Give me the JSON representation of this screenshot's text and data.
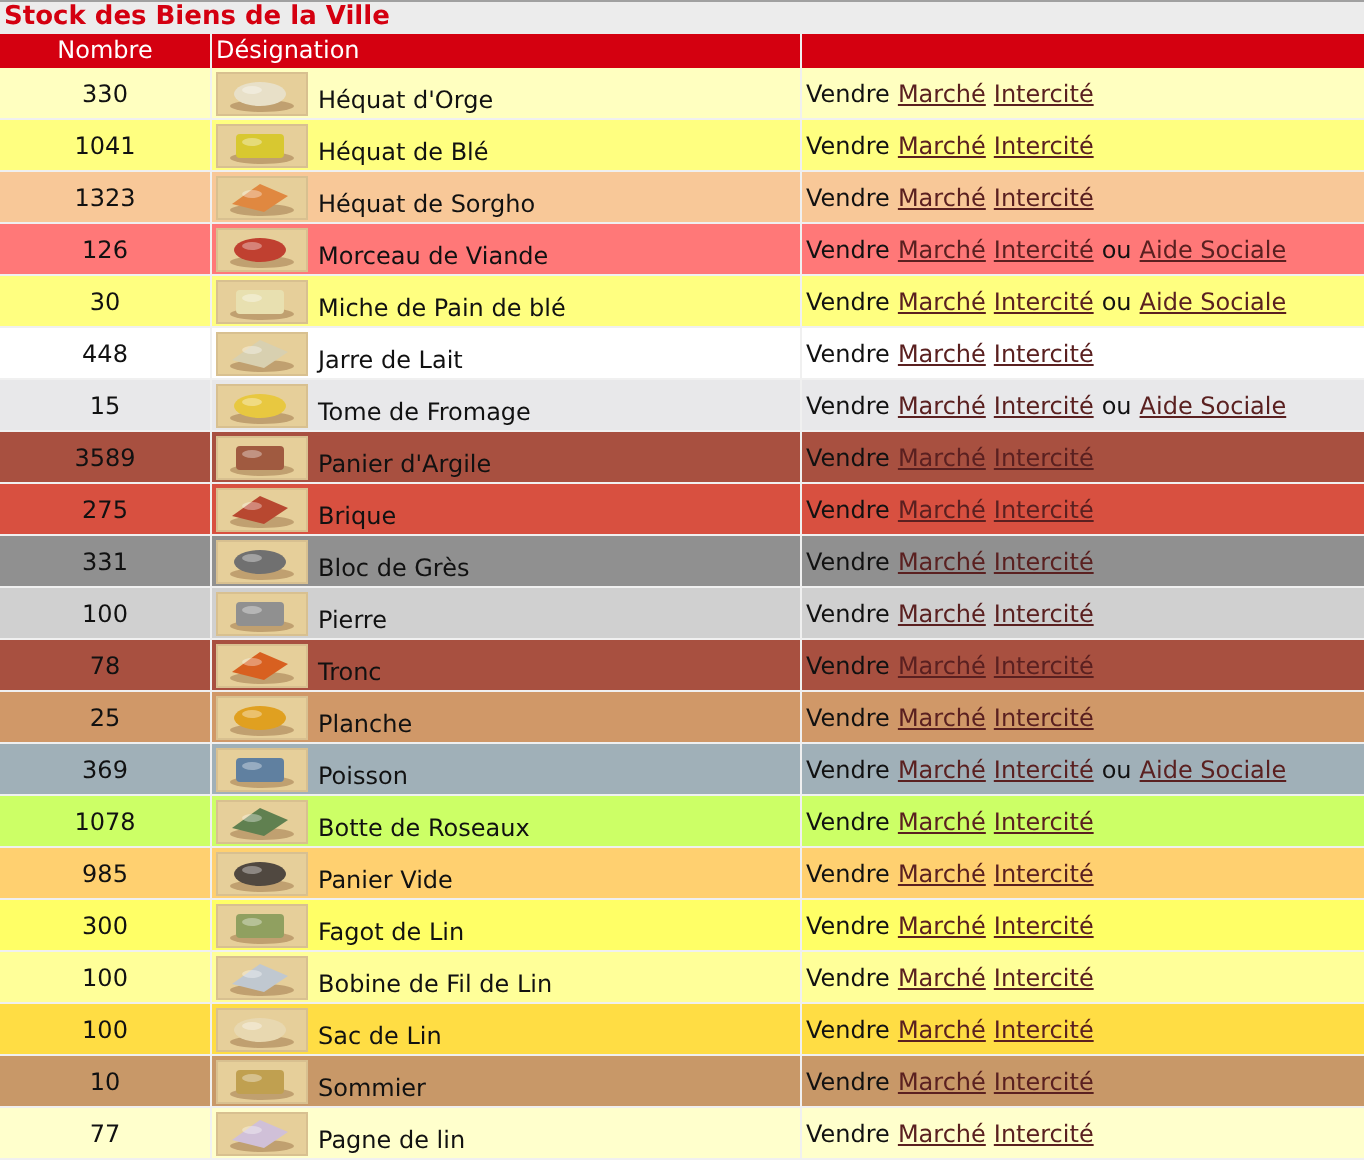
{
  "title": "Stock des Biens de la Ville",
  "columns": [
    "Nombre",
    "Désignation"
  ],
  "rows": [
    {
      "count": "330",
      "name": "Héquat d'Orge",
      "color": "#ffffc0",
      "actions": [
        {
          "kind": "text",
          "text": "Vendre"
        },
        {
          "kind": "link",
          "text": "Marché"
        },
        {
          "kind": "link",
          "text": "Intercité"
        }
      ]
    },
    {
      "count": "1041",
      "name": "Héquat de Blé",
      "color": "#ffff80",
      "actions": [
        {
          "kind": "text",
          "text": "Vendre"
        },
        {
          "kind": "link",
          "text": "Marché"
        },
        {
          "kind": "link",
          "text": "Intercité"
        }
      ]
    },
    {
      "count": "1323",
      "name": "Héquat de Sorgho",
      "color": "#f8c898",
      "actions": [
        {
          "kind": "text",
          "text": "Vendre"
        },
        {
          "kind": "link",
          "text": "Marché"
        },
        {
          "kind": "link",
          "text": "Intercité"
        }
      ]
    },
    {
      "count": "126",
      "name": "Morceau de Viande",
      "color": "#ff7878",
      "actions": [
        {
          "kind": "text",
          "text": "Vendre"
        },
        {
          "kind": "link",
          "text": "Marché"
        },
        {
          "kind": "link",
          "text": "Intercité"
        },
        {
          "kind": "text",
          "text": "ou"
        },
        {
          "kind": "link",
          "text": "Aide Sociale"
        }
      ]
    },
    {
      "count": "30",
      "name": "Miche de Pain de blé",
      "color": "#ffff80",
      "actions": [
        {
          "kind": "text",
          "text": "Vendre"
        },
        {
          "kind": "link",
          "text": "Marché"
        },
        {
          "kind": "link",
          "text": "Intercité"
        },
        {
          "kind": "text",
          "text": "ou"
        },
        {
          "kind": "link",
          "text": "Aide Sociale"
        }
      ]
    },
    {
      "count": "448",
      "name": "Jarre de Lait",
      "color": "#ffffff",
      "actions": [
        {
          "kind": "text",
          "text": "Vendre"
        },
        {
          "kind": "link",
          "text": "Marché"
        },
        {
          "kind": "link",
          "text": "Intercité"
        }
      ]
    },
    {
      "count": "15",
      "name": "Tome de Fromage",
      "color": "#e8e8ea",
      "actions": [
        {
          "kind": "text",
          "text": "Vendre"
        },
        {
          "kind": "link",
          "text": "Marché"
        },
        {
          "kind": "link",
          "text": "Intercité"
        },
        {
          "kind": "text",
          "text": "ou"
        },
        {
          "kind": "link",
          "text": "Aide Sociale"
        }
      ]
    },
    {
      "count": "3589",
      "name": "Panier d'Argile",
      "color": "#a85040",
      "actions": [
        {
          "kind": "text",
          "text": "Vendre"
        },
        {
          "kind": "link",
          "text": "Marché"
        },
        {
          "kind": "link",
          "text": "Intercité"
        }
      ]
    },
    {
      "count": "275",
      "name": "Brique",
      "color": "#d85040",
      "actions": [
        {
          "kind": "text",
          "text": "Vendre"
        },
        {
          "kind": "link",
          "text": "Marché"
        },
        {
          "kind": "link",
          "text": "Intercité"
        }
      ]
    },
    {
      "count": "331",
      "name": "Bloc de Grès",
      "color": "#909090",
      "actions": [
        {
          "kind": "text",
          "text": "Vendre"
        },
        {
          "kind": "link",
          "text": "Marché"
        },
        {
          "kind": "link",
          "text": "Intercité"
        }
      ]
    },
    {
      "count": "100",
      "name": "Pierre",
      "color": "#d0d0d0",
      "actions": [
        {
          "kind": "text",
          "text": "Vendre"
        },
        {
          "kind": "link",
          "text": "Marché"
        },
        {
          "kind": "link",
          "text": "Intercité"
        }
      ]
    },
    {
      "count": "78",
      "name": "Tronc",
      "color": "#a85040",
      "actions": [
        {
          "kind": "text",
          "text": "Vendre"
        },
        {
          "kind": "link",
          "text": "Marché"
        },
        {
          "kind": "link",
          "text": "Intercité"
        }
      ]
    },
    {
      "count": "25",
      "name": "Planche",
      "color": "#d09868",
      "actions": [
        {
          "kind": "text",
          "text": "Vendre"
        },
        {
          "kind": "link",
          "text": "Marché"
        },
        {
          "kind": "link",
          "text": "Intercité"
        }
      ]
    },
    {
      "count": "369",
      "name": "Poisson",
      "color": "#a0b0b8",
      "actions": [
        {
          "kind": "text",
          "text": "Vendre"
        },
        {
          "kind": "link",
          "text": "Marché"
        },
        {
          "kind": "link",
          "text": "Intercité"
        },
        {
          "kind": "text",
          "text": "ou"
        },
        {
          "kind": "link",
          "text": "Aide Sociale"
        }
      ]
    },
    {
      "count": "1078",
      "name": "Botte de Roseaux",
      "color": "#ccff66",
      "actions": [
        {
          "kind": "text",
          "text": "Vendre"
        },
        {
          "kind": "link",
          "text": "Marché"
        },
        {
          "kind": "link",
          "text": "Intercité"
        }
      ]
    },
    {
      "count": "985",
      "name": "Panier Vide",
      "color": "#ffd070",
      "actions": [
        {
          "kind": "text",
          "text": "Vendre"
        },
        {
          "kind": "link",
          "text": "Marché"
        },
        {
          "kind": "link",
          "text": "Intercité"
        }
      ]
    },
    {
      "count": "300",
      "name": "Fagot de Lin",
      "color": "#ffff66",
      "actions": [
        {
          "kind": "text",
          "text": "Vendre"
        },
        {
          "kind": "link",
          "text": "Marché"
        },
        {
          "kind": "link",
          "text": "Intercité"
        }
      ]
    },
    {
      "count": "100",
      "name": "Bobine de Fil de Lin",
      "color": "#ffff99",
      "actions": [
        {
          "kind": "text",
          "text": "Vendre"
        },
        {
          "kind": "link",
          "text": "Marché"
        },
        {
          "kind": "link",
          "text": "Intercité"
        }
      ]
    },
    {
      "count": "100",
      "name": "Sac de Lin",
      "color": "#ffdd44",
      "actions": [
        {
          "kind": "text",
          "text": "Vendre"
        },
        {
          "kind": "link",
          "text": "Marché"
        },
        {
          "kind": "link",
          "text": "Intercité"
        }
      ]
    },
    {
      "count": "10",
      "name": "Sommier",
      "color": "#c89868",
      "actions": [
        {
          "kind": "text",
          "text": "Vendre"
        },
        {
          "kind": "link",
          "text": "Marché"
        },
        {
          "kind": "link",
          "text": "Intercité"
        }
      ]
    },
    {
      "count": "77",
      "name": "Pagne de lin",
      "color": "#ffffcc",
      "actions": [
        {
          "kind": "text",
          "text": "Vendre"
        },
        {
          "kind": "link",
          "text": "Marché"
        },
        {
          "kind": "link",
          "text": "Intercité"
        }
      ]
    }
  ]
}
